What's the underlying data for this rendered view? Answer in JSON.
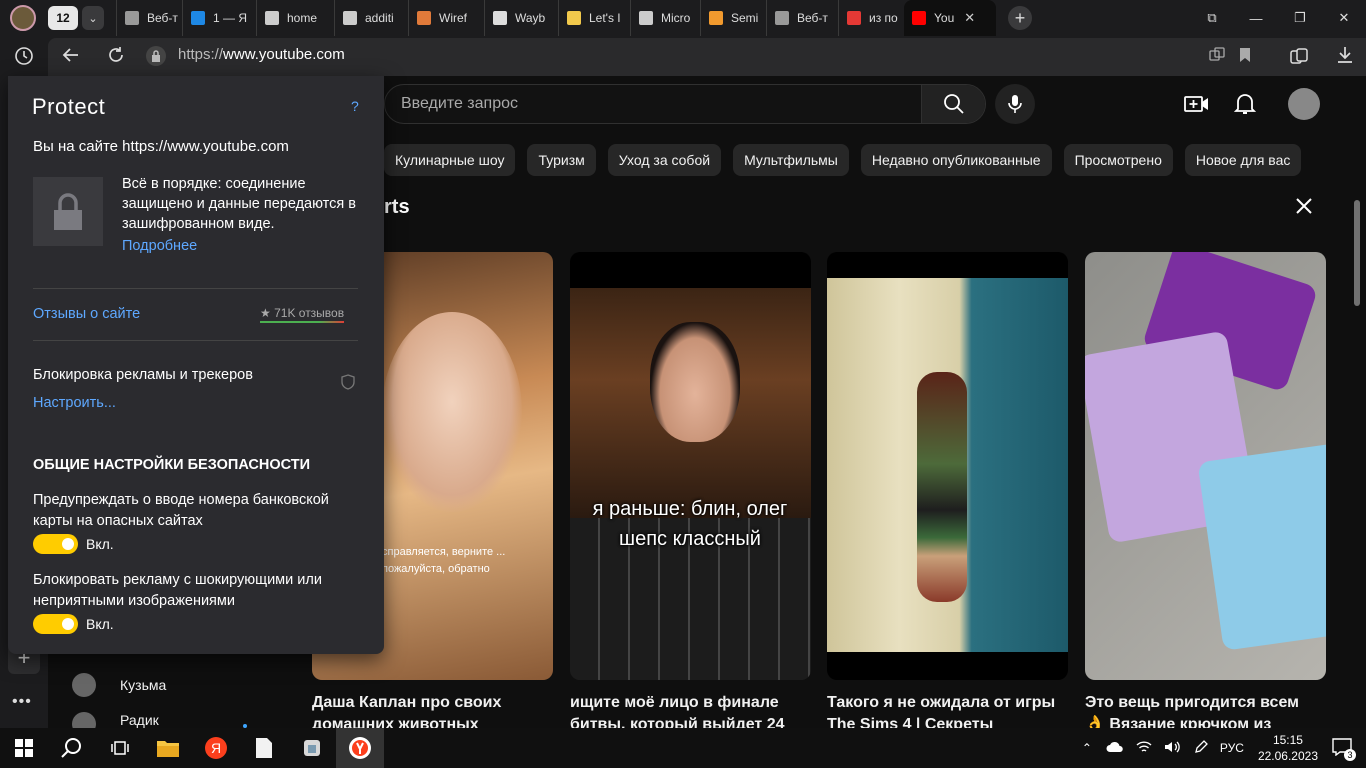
{
  "browser": {
    "tab_count": "12",
    "tabs": [
      {
        "label": "Веб-т",
        "fav": "#999"
      },
      {
        "label": "1 — Я",
        "fav": "#1e88e5"
      },
      {
        "label": "home",
        "fav": "#ccc"
      },
      {
        "label": "additi",
        "fav": "#ccc"
      },
      {
        "label": "Wiref",
        "fav": "#e07a3a"
      },
      {
        "label": "Wayb",
        "fav": "#ddd"
      },
      {
        "label": "Let's I",
        "fav": "#f2c94c"
      },
      {
        "label": "Micro",
        "fav": "#ccc"
      },
      {
        "label": "Semi",
        "fav": "#f29a2e"
      },
      {
        "label": "Веб-т",
        "fav": "#999"
      },
      {
        "label": "из по",
        "fav": "#e53935"
      },
      {
        "label": "You",
        "fav": "#ff0000"
      }
    ],
    "url_scheme": "https://",
    "url_host": "www.youtube.com"
  },
  "youtube": {
    "search_placeholder": "Введите запрос",
    "chips": [
      "Кулинарные шоу",
      "Туризм",
      "Уход за собой",
      "Мультфильмы",
      "Недавно опубликованные",
      "Просмотрено",
      "Новое для вас"
    ],
    "shorts_title_visible": "rts",
    "shorts": [
      {
        "title": "Даша Каплан про своих домашних животных",
        "overlay_caption": "справляется, верните ... пожалуйста, обратно"
      },
      {
        "title": "ищите моё лицо в финале битвы, который выйдет 24",
        "overlay_caption": "я раньше: блин, олег шепс классный"
      },
      {
        "title": "Такого я не ожидала от игры The Sims 4 | Секреты",
        "overlay_caption": ""
      },
      {
        "title": "Это вещь пригодится всем 👌 Вязание крючком из",
        "overlay_caption": ""
      }
    ],
    "channels": [
      "Кузьма",
      "Радик"
    ]
  },
  "protect": {
    "title": "Protect",
    "help": "?",
    "site_line": "Вы на сайте https://www.youtube.com",
    "status_text": "Всё в порядке: соединение защищено и данные передаются в зашифрованном виде.",
    "more_link": "Подробнее",
    "reviews_link": "Отзывы о сайте",
    "reviews_count": "★ 71K отзывов",
    "adblock_label": "Блокировка рекламы и трекеров",
    "configure_link": "Настроить...",
    "general_heading": "ОБЩИЕ НАСТРОЙКИ БЕЗОПАСНОСТИ",
    "option1_text": "Предупреждать о вводе номера банковской карты на опасных сайтах",
    "option1_state": "Вкл.",
    "option2_text": "Блокировать рекламу с шокирующими или неприятными изображениями",
    "option2_state": "Вкл."
  },
  "taskbar": {
    "lang": "РУС",
    "time": "15:15",
    "date": "22.06.2023",
    "notif_count": "3"
  }
}
